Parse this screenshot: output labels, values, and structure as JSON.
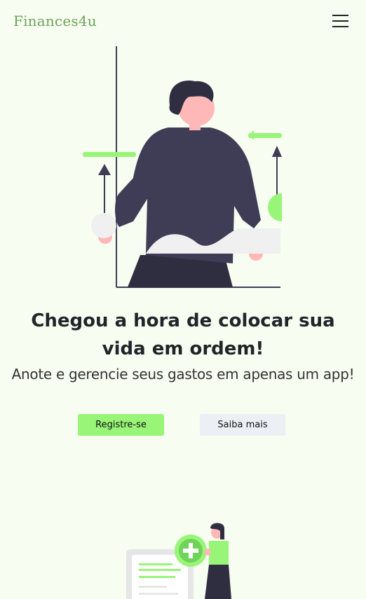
{
  "navbar": {
    "brand": "Finances4u",
    "menu_icon": "hamburger-menu-icon"
  },
  "hero": {
    "illustration": "person-with-growth-chart-illustration",
    "headline": "Chegou a hora de colocar sua vida em ordem!",
    "subtitle": "Anote e gerencie seus gastos em apenas um app!",
    "primary_button": "Registre-se",
    "secondary_button": "Saiba mais"
  },
  "section2": {
    "illustration": "person-adding-document-illustration"
  },
  "colors": {
    "background": "#f7fdf0",
    "brand": "#6fa35a",
    "accent_green": "#98f577",
    "secondary_button": "#eceff3",
    "figure_dark": "#3f3d56"
  }
}
